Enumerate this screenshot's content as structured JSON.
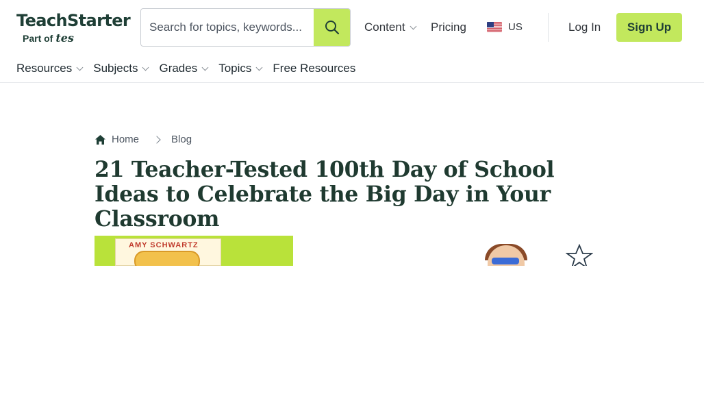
{
  "header": {
    "logo": {
      "wordmark": "TeachStarter",
      "part_of": "Part of",
      "tes": "tes"
    },
    "search": {
      "placeholder": "Search for topics, keywords...",
      "value": ""
    },
    "nav": {
      "content": "Content",
      "pricing": "Pricing",
      "region": "US"
    },
    "login": "Log In",
    "signup": "Sign Up",
    "subnav": [
      {
        "label": "Resources",
        "has_dropdown": true
      },
      {
        "label": "Subjects",
        "has_dropdown": true
      },
      {
        "label": "Grades",
        "has_dropdown": true
      },
      {
        "label": "Topics",
        "has_dropdown": true
      },
      {
        "label": "Free Resources",
        "has_dropdown": false
      }
    ],
    "colors": {
      "accent": "#c2e85d",
      "text": "#1f3f36"
    }
  },
  "breadcrumb": {
    "home": "Home",
    "current": "Blog"
  },
  "article": {
    "title": "21 Teacher-Tested 100th Day of School Ideas to Celebrate the Big Day in Your Classroom",
    "hero_book_author": "AMY SCHWARTZ"
  }
}
